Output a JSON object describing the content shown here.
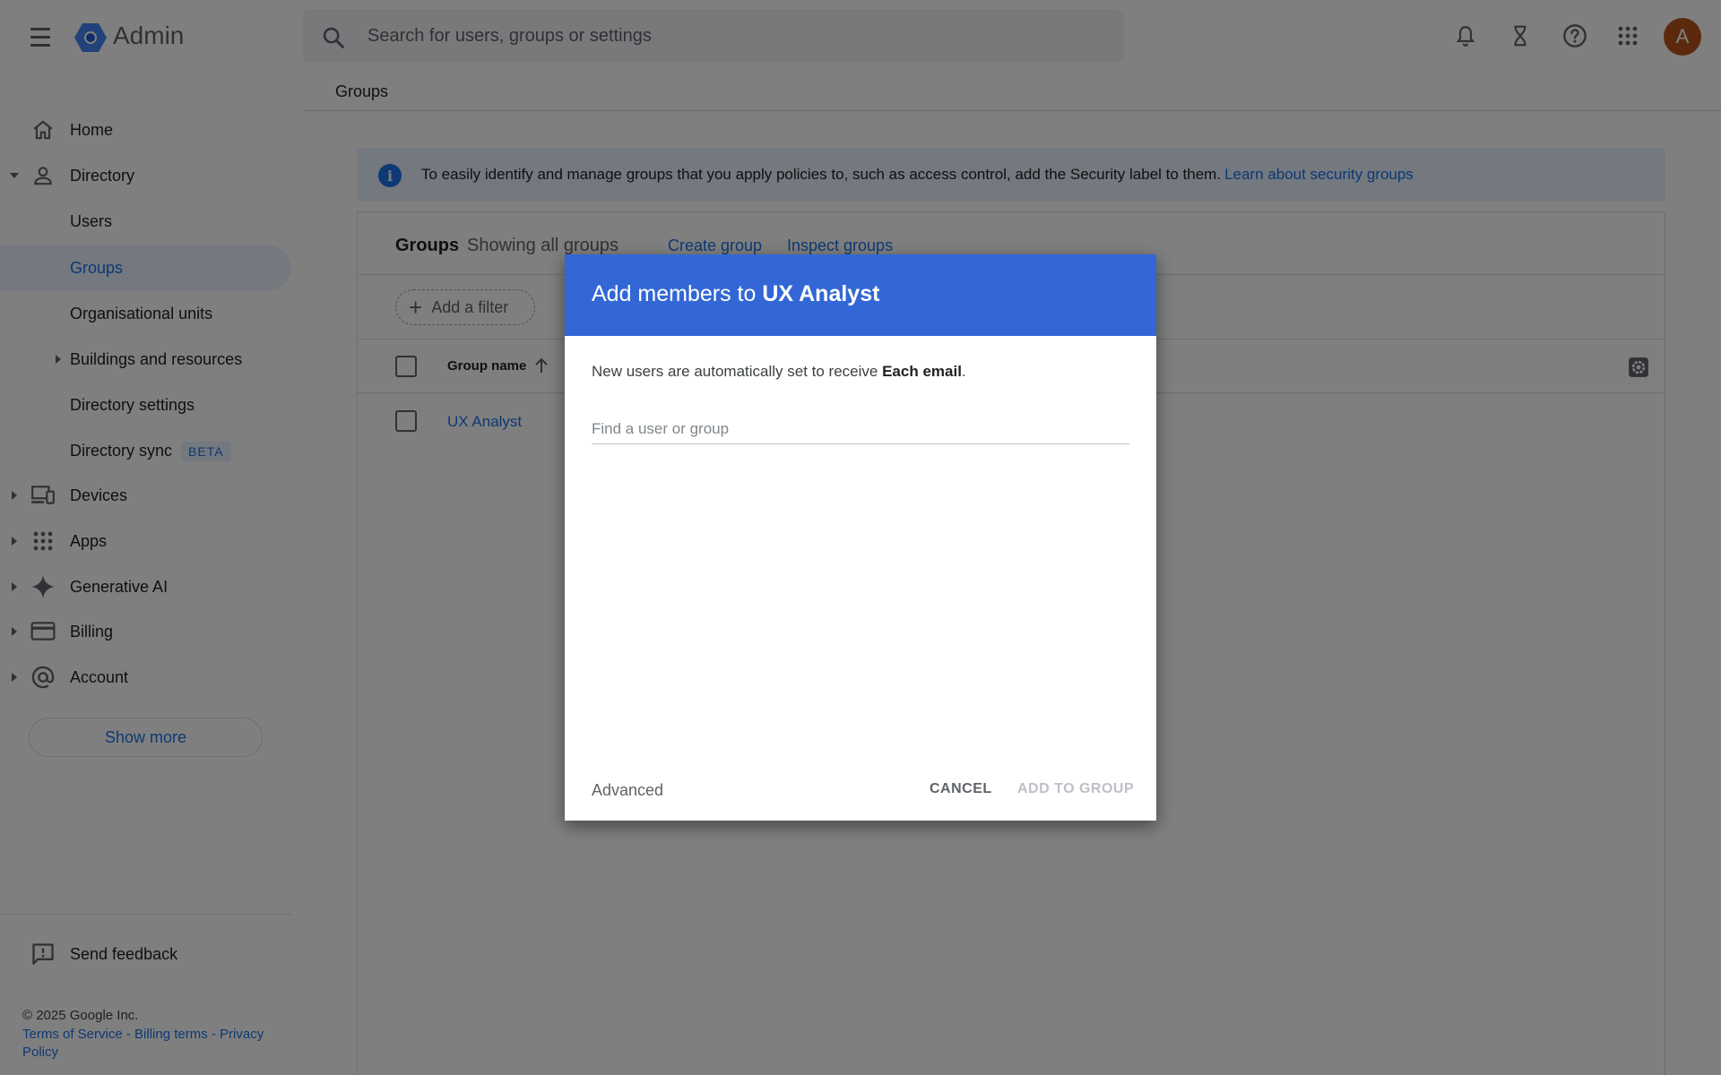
{
  "app": {
    "title": "Admin",
    "search_placeholder": "Search for users, groups or settings",
    "avatar_letter": "A",
    "colors": {
      "accent": "#1a73e8",
      "dialog_header": "#3367d6",
      "avatar": "#b6521c"
    }
  },
  "icons": {
    "top": [
      "bell-icon",
      "hourglass-icon",
      "help-icon",
      "apps-grid-icon"
    ],
    "nav": [
      "home-icon",
      "person-icon",
      "devices-icon",
      "apps-grid-icon",
      "sparkle-icon",
      "credit-card-icon",
      "at-sign-icon"
    ]
  },
  "breadcrumb": {
    "label": "Groups"
  },
  "sidebar": {
    "items": [
      {
        "label": "Home"
      },
      {
        "label": "Directory"
      },
      {
        "label": "Users"
      },
      {
        "label": "Groups"
      },
      {
        "label": "Organisational units"
      },
      {
        "label": "Buildings and resources"
      },
      {
        "label": "Directory settings"
      },
      {
        "label": "Directory sync",
        "badge": "BETA"
      },
      {
        "label": "Devices"
      },
      {
        "label": "Apps"
      },
      {
        "label": "Generative AI"
      },
      {
        "label": "Billing"
      },
      {
        "label": "Account"
      }
    ],
    "show_more": "Show more",
    "feedback": "Send feedback",
    "copyright": "© 2025 Google Inc.",
    "legal": "Terms of Service - Billing terms - Privacy Policy"
  },
  "banner": {
    "text": "To easily identify and manage groups that you apply policies to, such as access control, add the Security label to them.",
    "link": "Learn about security groups"
  },
  "groups": {
    "title": "Groups",
    "subtitle": "Showing all groups",
    "create_link": "Create group",
    "inspect_link": "Inspect groups",
    "add_filter": "Add a filter",
    "column_header": "Group name",
    "rows": [
      {
        "name": "UX Analyst"
      }
    ]
  },
  "dialog": {
    "title_prefix": "Add members to",
    "group_name": "UX Analyst",
    "note_prefix": "New users are automatically set to receive",
    "note_bold": "Each email",
    "note_suffix": ".",
    "find_placeholder": "Find a user or group",
    "advanced": "Advanced",
    "cancel": "CANCEL",
    "add": "ADD TO GROUP"
  }
}
